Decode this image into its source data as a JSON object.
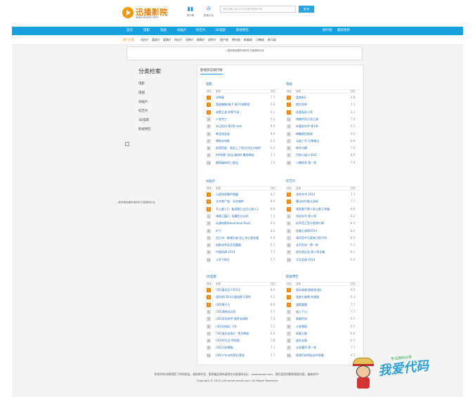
{
  "header": {
    "logo_text": "迅播影院",
    "logo_url": "www.eenot.com",
    "icons": [
      {
        "icon": "bar-chart-icon",
        "label": "排行榜"
      },
      {
        "icon": "film-reel-icon",
        "label": "影视大全"
      }
    ],
    "search_placeholder": "请在此输入影片中文或者拼音首字母",
    "search_button": "搜 索"
  },
  "nav": {
    "items": [
      "首页",
      "电影",
      "电视",
      "动画片",
      "综艺片",
      "3D电影",
      "影视预告",
      "排行榜",
      "最新更新"
    ]
  },
  "tags": {
    "label": "热门分类",
    "items": [
      "动作片",
      "喜剧片",
      "爱情片",
      "科幻片",
      "恐怖片",
      "剧情片",
      "战争片",
      "国产剧",
      "港台剧",
      "欧美剧",
      "日韩剧",
      "新马泰"
    ]
  },
  "ad_text": "—更多精品源码请到东方星源码论坛",
  "sidebar": {
    "title": "分类检索",
    "items": [
      "电影",
      "电视",
      "动画片",
      "综艺片",
      "3D电影",
      "影视预告"
    ]
  },
  "float_ad_text": "—更多精品源码请到东方星源码论坛",
  "main": {
    "tab": "影视风云排行榜",
    "col_rank": "排名",
    "col_name": "名称",
    "col_score": "评分",
    "panels": [
      {
        "title": "电影",
        "rows": [
          {
            "rank": "1",
            "name": "恐怖屋",
            "score": "7.7"
          },
          {
            "rank": "2",
            "name": "超级蜘蛛(猴子·猴子)电影版",
            "score": "9.6"
          },
          {
            "rank": "3",
            "name": "赤壁之战·赤壁不战",
            "score": "6.2"
          },
          {
            "rank": "4",
            "name": "少女特工",
            "score": "5.1"
          },
          {
            "rank": "5",
            "name": "末日危机·第2季·岛屿",
            "score": "8.9"
          },
          {
            "rank": "6",
            "name": "哪里找女星",
            "score": "8.9"
          },
          {
            "rank": "7",
            "name": "雪狼谷电影",
            "score": "6.5"
          },
          {
            "rank": "8",
            "name": "部落宿星：我这上了阳光开往大地的",
            "score": "6.0"
          },
          {
            "rank": "9",
            "name": "WAN港门风云·精神4·爆发降临",
            "score": "7.7"
          },
          {
            "rank": "10",
            "name": "跳跃破碎的三星连",
            "score": "7.6"
          }
        ]
      },
      {
        "title": "电视",
        "rows": [
          {
            "rank": "1",
            "name": "猛鬼街2",
            "score": "4.8"
          },
          {
            "rank": "2",
            "name": "绝世武神",
            "score": "7.1"
          },
          {
            "rank": "3",
            "name": "欢喜冤家二季",
            "score": "6.2"
          },
          {
            "rank": "4",
            "name": "胡佛传奇之恶之源",
            "score": "7.4"
          },
          {
            "rank": "5",
            "name": "轩辕剑外传 第1季",
            "score": "9.5"
          },
          {
            "rank": "6",
            "name": "神雕侠侣新版",
            "score": "9.5"
          },
          {
            "rank": "7",
            "name": "无敌三世·天降神兵",
            "score": "8.6"
          },
          {
            "rank": "8",
            "name": "神奇马桶",
            "score": "7.0"
          },
          {
            "rank": "9",
            "name": "百斯小姐 Is KILL",
            "score": "8.9"
          },
          {
            "rank": "10",
            "name": "小猪佩奇 第一季",
            "score": "7.4"
          }
        ]
      },
      {
        "title": "动画片",
        "rows": [
          {
            "rank": "1",
            "name": "心理游戏事件揭露",
            "score": "8.7"
          },
          {
            "rank": "2",
            "name": "东京食尸鬼：东京喰种",
            "score": "8.9"
          },
          {
            "rank": "3",
            "name": "开心超人2：能源星之战开心超人2",
            "score": "8.6"
          },
          {
            "rank": "4",
            "name": "海贼王篇2：恶魔的分水岭",
            "score": "7.4"
          },
          {
            "rank": "5",
            "name": "动漫电影Bakumatsu Rock",
            "score": "9.3"
          },
          {
            "rank": "6",
            "name": "护卫",
            "score": "8.6"
          },
          {
            "rank": "7",
            "name": "恋之诗：破晓忍者·恋之诗之爱恋篇",
            "score": "6.9"
          },
          {
            "rank": "8",
            "name": "电影战争女巫恶魔篇",
            "score": "6.7"
          },
          {
            "rank": "9",
            "name": "中国奇谭 2014",
            "score": "7.7"
          },
          {
            "rank": "10",
            "name": "斗罗大陆Q",
            "score": "5.7"
          }
        ]
      },
      {
        "title": "综艺片",
        "rows": [
          {
            "rank": "1",
            "name": "花样年华 2014",
            "score": "7.7"
          },
          {
            "rank": "2",
            "name": "魔法时代星光游戏",
            "score": "7.7"
          },
          {
            "rank": "3",
            "name": "我是歌手第二季之歌王争霸",
            "score": "8.8"
          },
          {
            "rank": "4",
            "name": "花样年华 第二季",
            "score": "6.2"
          },
          {
            "rank": "5",
            "name": "好声音之音乐理想二期",
            "score": "8.5"
          },
          {
            "rank": "6",
            "name": "笑傲江湖第2014",
            "score": "8.5"
          },
          {
            "rank": "7",
            "name": "请问您今天要来点兔子吗",
            "score": "8.5"
          },
          {
            "rank": "8",
            "name": "读书狂欢：第一季",
            "score": "5.4"
          },
          {
            "rank": "9",
            "name": "现在就出发·第二季全集",
            "score": "8.1"
          },
          {
            "rank": "10",
            "name": "汉字英雄 2014",
            "score": "6.4"
          }
        ]
      },
      {
        "title": "3D电影",
        "rows": [
          {
            "rank": "1",
            "name": "(3D)泰坦巨人2011",
            "score": "8.0"
          },
          {
            "rank": "2",
            "name": "冒险家(3D)/古墓丽影大冒险",
            "score": "6.2"
          },
          {
            "rank": "3",
            "name": "(3D)狮子王",
            "score": "8.9"
          },
          {
            "rank": "4",
            "name": "(3D)海底总动员",
            "score": "7.7"
          },
          {
            "rank": "5",
            "name": "(3D)异形前传·普罗米修斯",
            "score": "7.4"
          },
          {
            "rank": "6",
            "name": "(3D)创战纪 飞车",
            "score": "7.1"
          },
          {
            "rank": "7",
            "name": "(3D)变形金刚3：黑月降临",
            "score": "6.6"
          },
          {
            "rank": "8",
            "name": "(3D)阿凡达·特别版",
            "score": "7.8"
          },
          {
            "rank": "9",
            "name": "(3D)功夫熊猫",
            "score": "7.1"
          },
          {
            "rank": "10",
            "name": "(3D)少年派的奇幻漂流",
            "score": "7.7"
          }
        ]
      },
      {
        "title": "影视预告",
        "rows": [
          {
            "rank": "1",
            "name": "星际穿越·超能陆战队",
            "score": "6.2"
          },
          {
            "rank": "2",
            "name": "速度与激情·终极版",
            "score": "6.3"
          },
          {
            "rank": "3",
            "name": "谍影重重",
            "score": "7.7"
          },
          {
            "rank": "4",
            "name": "道士下山",
            "score": "7.7"
          },
          {
            "rank": "5",
            "name": "勇敢传说",
            "score": "6.7"
          },
          {
            "rank": "6",
            "name": "火星救援",
            "score": "6.5"
          },
          {
            "rank": "7",
            "name": "青春之歌",
            "score": "6.6"
          },
          {
            "rank": "8",
            "name": "变形金刚",
            "score": "6.7"
          },
          {
            "rank": "9",
            "name": "全息魔术 第一季",
            "score": "7.7"
          },
          {
            "rank": "10",
            "name": "致我们终将逝去的青春",
            "score": "8.7"
          }
        ]
      }
    ]
  },
  "footer": {
    "line1": "免责声明:如果侵犯了你的权益，请发邮件至：更多精品源码请到东方星源码论坛 - www.eenot.com，我们会及时删除侵权内容，谢谢合作！",
    "line2": "Copyright © 2015 106.eenot.eenot.com. All Rights Reserved."
  },
  "watermark": {
    "text": "我爱代码",
    "small": "专注源码分享"
  }
}
